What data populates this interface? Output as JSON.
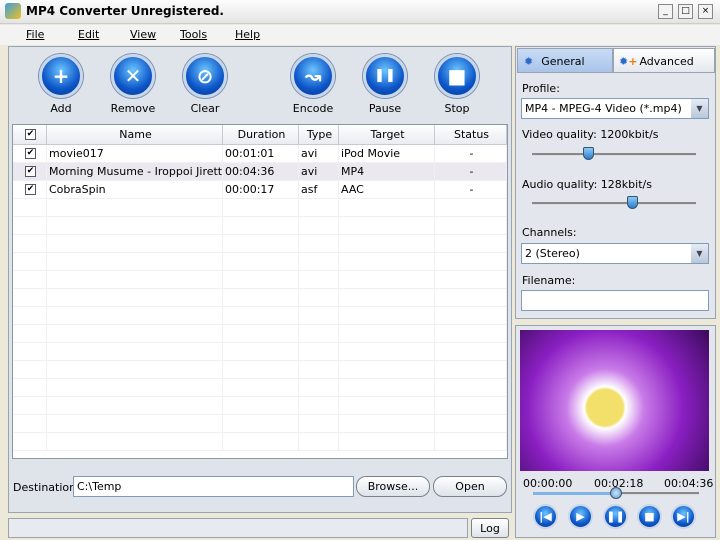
{
  "window": {
    "title": "MP4 Converter Unregistered."
  },
  "menu": [
    "File",
    "Edit",
    "View",
    "Tools",
    "Help"
  ],
  "toolbar": [
    {
      "label": "Add",
      "icon": "+"
    },
    {
      "label": "Remove",
      "icon": "✕"
    },
    {
      "label": "Clear",
      "icon": "⊘"
    },
    {
      "label": "Encode",
      "icon": "↝"
    },
    {
      "label": "Pause",
      "icon": "❚❚"
    },
    {
      "label": "Stop",
      "icon": "■"
    }
  ],
  "table": {
    "headers": [
      "Name",
      "Duration",
      "Type",
      "Target",
      "Status"
    ],
    "rows": [
      {
        "checked": true,
        "name": "movie017",
        "duration": "00:01:01",
        "type": "avi",
        "target": "iPod Movie",
        "status": "-"
      },
      {
        "checked": true,
        "name": "Morning Musume - Iroppoi Jirettai(nc",
        "duration": "00:04:36",
        "type": "avi",
        "target": "MP4",
        "status": "-"
      },
      {
        "checked": true,
        "name": "CobraSpin",
        "duration": "00:00:17",
        "type": "asf",
        "target": "AAC",
        "status": "-"
      }
    ]
  },
  "destination": {
    "label": "Destination:",
    "value": "C:\\Temp",
    "browse": "Browse...",
    "open": "Open"
  },
  "statusbar": {
    "log": "Log"
  },
  "settings": {
    "tabs": [
      "General",
      "Advanced"
    ],
    "profile_label": "Profile:",
    "profile": "MP4 - MPEG-4 Video  (*.mp4)",
    "video_quality_label": "Video quality: 1200kbit/s",
    "video_quality_fraction": 0.34,
    "audio_quality_label": "Audio quality: 128kbit/s",
    "audio_quality_fraction": 0.61,
    "channels_label": "Channels:",
    "channels": "2 (Stereo)",
    "filename_label": "Filename:",
    "filename": ""
  },
  "player": {
    "start": "00:00:00",
    "current": "00:02:18",
    "end": "00:04:36",
    "position_fraction": 0.5
  }
}
